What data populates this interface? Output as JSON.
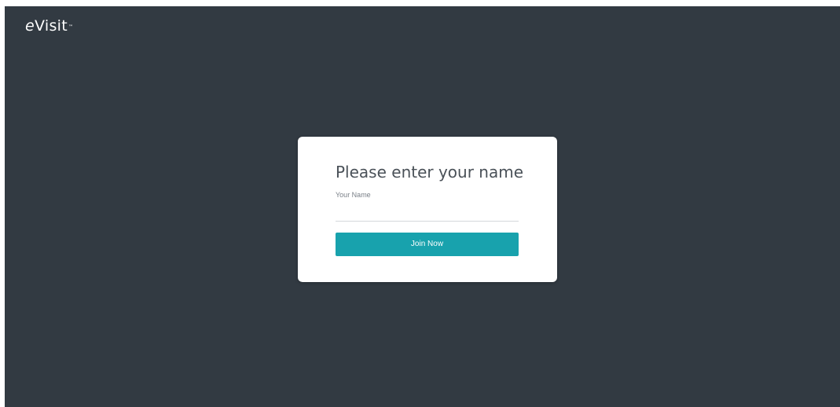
{
  "brand": {
    "logo_e": "e",
    "logo_rest": "Visit",
    "logo_tm": "™"
  },
  "dialog": {
    "title": "Please enter your name",
    "name_label": "Your Name",
    "name_value": "",
    "name_placeholder": "",
    "join_label": "Join Now"
  },
  "colors": {
    "background": "#323a42",
    "card": "#ffffff",
    "accent": "#18a2ad"
  }
}
